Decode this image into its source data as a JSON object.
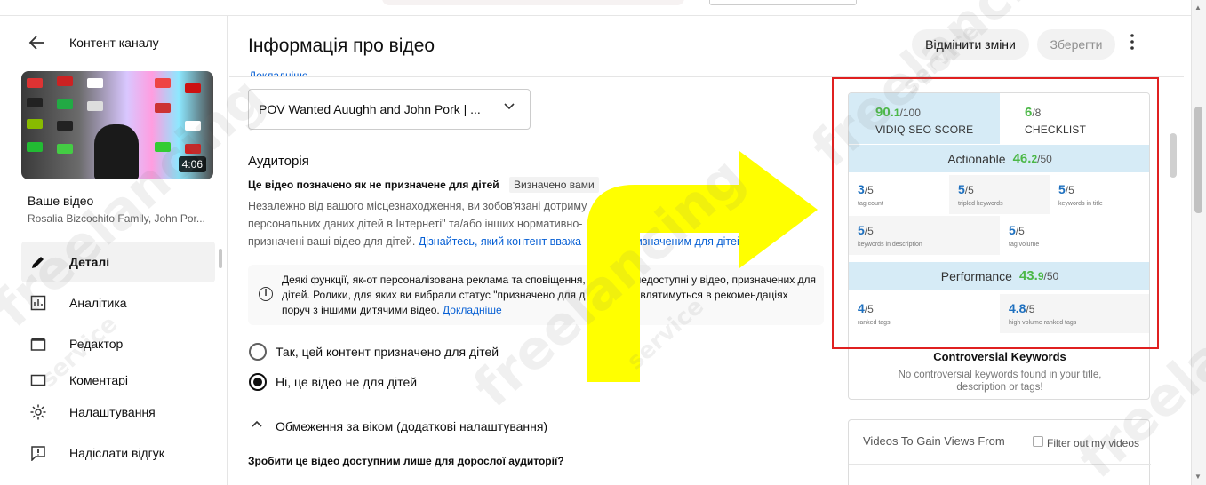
{
  "sidebar": {
    "back_icon": "arrow-left-icon",
    "title": "Контент каналу",
    "thumbnail_duration": "4:06",
    "your_video_label": "Ваше відео",
    "channel_name": "Rosalia Bizcochito Family, John Por...",
    "items": [
      {
        "label": "Деталі",
        "icon": "pencil-icon",
        "active": true
      },
      {
        "label": "Аналітика",
        "icon": "analytics-icon",
        "active": false
      },
      {
        "label": "Редактор",
        "icon": "clapperboard-icon",
        "active": false
      },
      {
        "label": "Коментарі",
        "icon": "comments-icon",
        "active": false
      }
    ],
    "footer_items": [
      {
        "label": "Налаштування",
        "icon": "gear-icon"
      },
      {
        "label": "Надіслати відгук",
        "icon": "feedback-icon"
      }
    ]
  },
  "header": {
    "title": "Інформація про відео",
    "undo_label": "Відмінити зміни",
    "save_label": "Зберегти",
    "more_icon": "more-vert-icon",
    "top_link": "Докладніше"
  },
  "main": {
    "playlist_value": "POV Wanted Auughh and John Pork | ...",
    "audience": {
      "title": "Аудиторія",
      "status": "Це відео позначено як не призначене для дітей",
      "status_badge": "Визначено вами",
      "description": "Незалежно від вашого місцезнаходження, ви зобов'язані дотримуватися ... недоступні у відео, призначених ... персональних даних дітей в Інтернеті\" та/або інших нормативно-... них актів, а також указувати, чи призначені ваші відео для дітей. ",
      "description_line1": "Незалежно від вашого місцезнаходження, ви зобов'язані дотриму",
      "description_line2": "персональних даних дітей в Інтернеті\" та/або інших нормативно-",
      "description_line2b": "их актів, а також указ",
      "description_line3": "призначені ваші відео для дітей. ",
      "description_link": "Дізнайтесь, який контент вважа",
      "description_link2": "призначеним для дітей",
      "notice_line1": "Деякі функції, як-от персоналізована реклама та сповіщення,",
      "notice_line1b": "недоступні у відео, призначених для",
      "notice_line2": "дітей. Ролики, для яких ви вибрали статус \"призначено для д",
      "notice_line2b": "стіше з'являтимуться в рекомендаціях",
      "notice_line3": "поруч з іншими дитячими відео. ",
      "notice_link": "Докладніше",
      "option_yes": "Так, цей контент призначено для дітей",
      "option_no": "Ні, це відео не для дітей",
      "selected": "no"
    },
    "age_restriction_title": "Обмеження за віком (додаткові налаштування)",
    "adult_question": "Зробити це відео доступним лише для дорослої аудиторії?"
  },
  "vidiq": {
    "seo_score": "90.1",
    "seo_score_main": "90.",
    "seo_score_dec": "1",
    "seo_score_max": "/100",
    "seo_label": "VIDIQ SEO SCORE",
    "checklist_score": "6",
    "checklist_max": "/8",
    "checklist_label": "CHECKLIST",
    "actionable_label": "Actionable",
    "actionable_main": "46.",
    "actionable_dec": "2",
    "actionable_max": "/50",
    "actionable_cells": [
      {
        "value": "3",
        "max": "/5",
        "label": "tag count"
      },
      {
        "value": "5",
        "max": "/5",
        "label": "tripled keywords"
      },
      {
        "value": "5",
        "max": "/5",
        "label": "keywords in title"
      },
      {
        "value": "5",
        "max": "/5",
        "label": "keywords in description"
      },
      {
        "value": "5",
        "max": "/5",
        "label": "tag volume"
      }
    ],
    "performance_label": "Performance",
    "performance_main": "43.",
    "performance_dec": "9",
    "performance_max": "/50",
    "performance_cells": [
      {
        "value": "4",
        "max": "/5",
        "label": "ranked tags"
      },
      {
        "value": "4.8",
        "max": "/5",
        "label": "high volume ranked tags"
      }
    ],
    "controversial_title": "Controversial Keywords",
    "controversial_text": "No controversial keywords found in your title, description or tags!",
    "gain_views_title": "Videos To Gain Views From",
    "filter_label": "Filter out my videos"
  },
  "overlay": {
    "arrow_color": "#ffff00",
    "highlight_color": "#e02020",
    "watermark_text": "freelancing",
    "watermark_sub": "service"
  }
}
